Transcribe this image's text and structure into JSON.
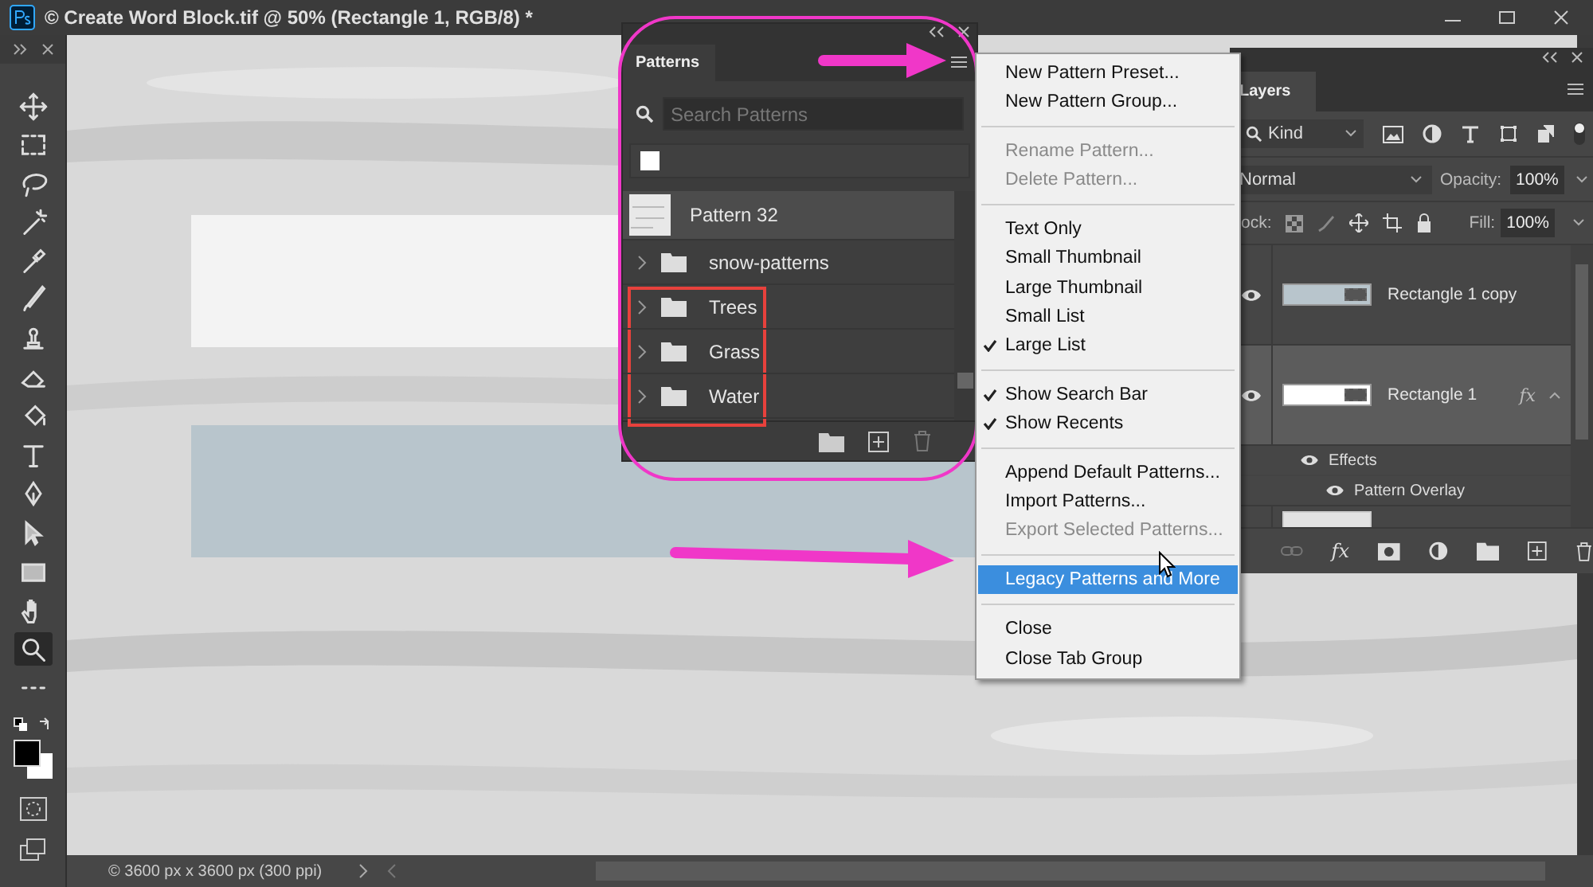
{
  "window": {
    "title": "© Create Word Block.tif @ 50% (Rectangle 1, RGB/8) *"
  },
  "tools": [
    {
      "kind": "move",
      "selected": false
    },
    {
      "kind": "marquee",
      "selected": false
    },
    {
      "kind": "lasso",
      "selected": false
    },
    {
      "kind": "wand",
      "selected": false
    },
    {
      "kind": "eyedropper",
      "selected": false
    },
    {
      "kind": "brush",
      "selected": false
    },
    {
      "kind": "stamp",
      "selected": false
    },
    {
      "kind": "eraser",
      "selected": false
    },
    {
      "kind": "bucket",
      "selected": false
    },
    {
      "kind": "type",
      "selected": false
    },
    {
      "kind": "pen",
      "selected": false
    },
    {
      "kind": "select",
      "selected": false
    },
    {
      "kind": "rectangle",
      "selected": false
    },
    {
      "kind": "hand",
      "selected": false
    },
    {
      "kind": "zoom",
      "selected": true
    },
    {
      "kind": "more",
      "selected": false
    }
  ],
  "patterns_panel": {
    "tab": "Patterns",
    "search": {
      "placeholder": "Search Patterns"
    },
    "items": [
      {
        "kind": "pattern",
        "label": "Pattern 32",
        "selected": true
      },
      {
        "kind": "group",
        "label": "snow-patterns",
        "selected": false,
        "expanded": false
      },
      {
        "kind": "group",
        "label": "Trees",
        "selected": false,
        "expanded": false
      },
      {
        "kind": "group",
        "label": "Grass",
        "selected": false,
        "expanded": false
      },
      {
        "kind": "group",
        "label": "Water",
        "selected": false,
        "expanded": false
      }
    ]
  },
  "menu": {
    "groups": [
      [
        {
          "label": "New Pattern Preset...",
          "disabled": false,
          "checked": false,
          "selected": false
        },
        {
          "label": "New Pattern Group...",
          "disabled": false,
          "checked": false,
          "selected": false
        }
      ],
      [
        {
          "label": "Rename Pattern...",
          "disabled": true,
          "checked": false,
          "selected": false
        },
        {
          "label": "Delete Pattern...",
          "disabled": true,
          "checked": false,
          "selected": false
        }
      ],
      [
        {
          "label": "Text Only",
          "disabled": false,
          "checked": false,
          "selected": false
        },
        {
          "label": "Small Thumbnail",
          "disabled": false,
          "checked": false,
          "selected": false
        },
        {
          "label": "Large Thumbnail",
          "disabled": false,
          "checked": false,
          "selected": false
        },
        {
          "label": "Small List",
          "disabled": false,
          "checked": false,
          "selected": false
        },
        {
          "label": "Large List",
          "disabled": false,
          "checked": true,
          "selected": false
        }
      ],
      [
        {
          "label": "Show Search Bar",
          "disabled": false,
          "checked": true,
          "selected": false
        },
        {
          "label": "Show Recents",
          "disabled": false,
          "checked": true,
          "selected": false
        }
      ],
      [
        {
          "label": "Append Default Patterns...",
          "disabled": false,
          "checked": false,
          "selected": false
        },
        {
          "label": "Import Patterns...",
          "disabled": false,
          "checked": false,
          "selected": false
        },
        {
          "label": "Export Selected Patterns...",
          "disabled": true,
          "checked": false,
          "selected": false
        }
      ],
      [
        {
          "label": "Legacy Patterns and More",
          "disabled": false,
          "checked": false,
          "selected": true
        }
      ],
      [
        {
          "label": "Close",
          "disabled": false,
          "checked": false,
          "selected": false
        },
        {
          "label": "Close Tab Group",
          "disabled": false,
          "checked": false,
          "selected": false
        }
      ]
    ]
  },
  "layers_panel": {
    "tab": "Layers",
    "filter": "Kind",
    "blend_mode": "Normal",
    "opacity_label": "Opacity:",
    "opacity": "100%",
    "lock_label": "ock:",
    "fill_label": "Fill:",
    "fill": "100%",
    "footer_fx": "fx",
    "layers": [
      {
        "name": "Rectangle 1 copy",
        "kind": "bar-blue",
        "visible": true,
        "selected": false
      },
      {
        "name": "Rectangle 1",
        "kind": "bar-white",
        "visible": true,
        "selected": true,
        "fx_badge": "fx",
        "effects": {
          "label": "Effects",
          "items": [
            "Pattern Overlay"
          ]
        }
      },
      {
        "kind": "texture",
        "selected": false
      }
    ]
  },
  "status_bar": {
    "doc_info": "© 3600 px x 3600 px (300 ppi)"
  }
}
